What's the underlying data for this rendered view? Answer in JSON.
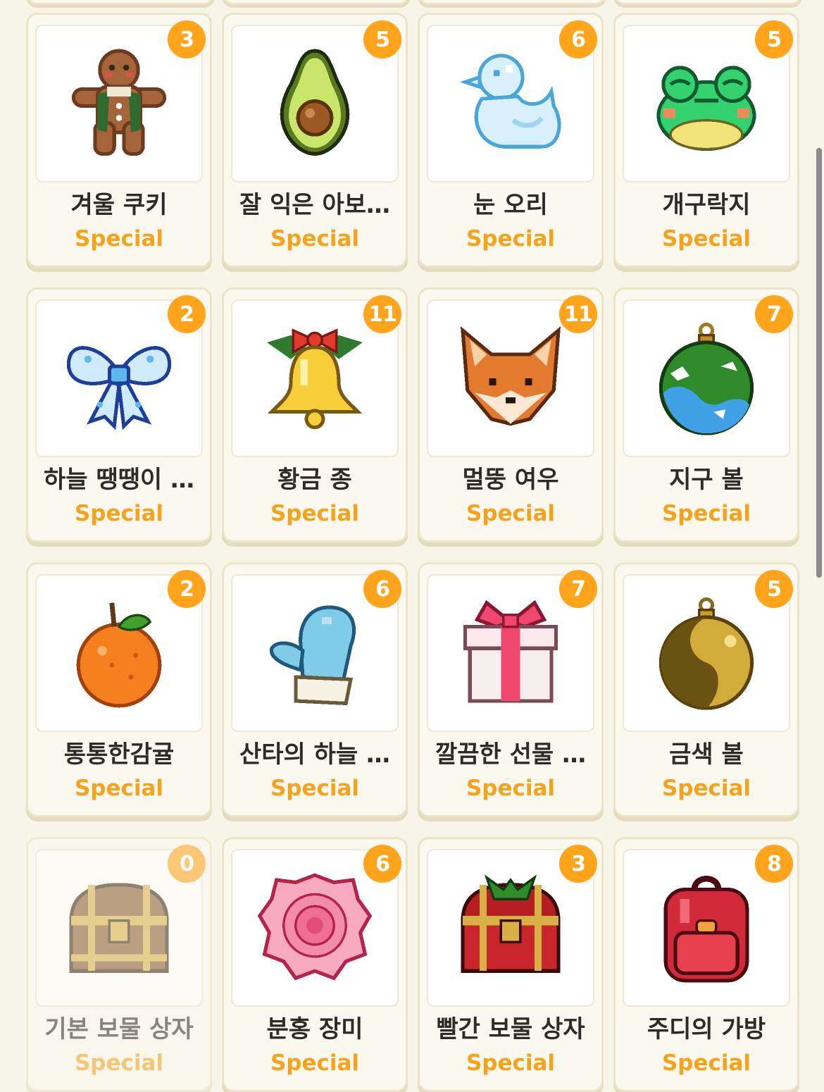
{
  "colors": {
    "background": "#f7f4e8",
    "card": "#fbf9ef",
    "badge": "#ffa41b",
    "rarity": "#f5a21c",
    "name": "#2f2a25"
  },
  "items": [
    {
      "name": "겨울 쿠키",
      "rarity": "Special",
      "count": "3",
      "icon": "gingerbread-man-icon"
    },
    {
      "name": "잘 익은 아보…",
      "rarity": "Special",
      "count": "5",
      "icon": "avocado-icon"
    },
    {
      "name": "눈 오리",
      "rarity": "Special",
      "count": "6",
      "icon": "snow-duck-icon"
    },
    {
      "name": "개구락지",
      "rarity": "Special",
      "count": "5",
      "icon": "frog-icon"
    },
    {
      "name": "하늘 땡땡이 …",
      "rarity": "Special",
      "count": "2",
      "icon": "blue-ribbon-bow-icon"
    },
    {
      "name": "황금 종",
      "rarity": "Special",
      "count": "11",
      "icon": "golden-bell-icon"
    },
    {
      "name": "멀뚱 여우",
      "rarity": "Special",
      "count": "11",
      "icon": "fox-face-icon"
    },
    {
      "name": "지구 볼",
      "rarity": "Special",
      "count": "7",
      "icon": "earth-ornament-icon"
    },
    {
      "name": "통통한감귤",
      "rarity": "Special",
      "count": "2",
      "icon": "tangerine-icon"
    },
    {
      "name": "산타의 하늘 …",
      "rarity": "Special",
      "count": "6",
      "icon": "blue-mitten-icon"
    },
    {
      "name": "깔끔한 선물 …",
      "rarity": "Special",
      "count": "7",
      "icon": "gift-box-icon"
    },
    {
      "name": "금색 볼",
      "rarity": "Special",
      "count": "5",
      "icon": "gold-ornament-icon"
    },
    {
      "name": "기본 보물 상자",
      "rarity": "Special",
      "count": "0",
      "icon": "treasure-chest-icon"
    },
    {
      "name": "분홍 장미",
      "rarity": "Special",
      "count": "6",
      "icon": "pink-rose-icon"
    },
    {
      "name": "빨간 보물 상자",
      "rarity": "Special",
      "count": "3",
      "icon": "red-treasure-chest-icon"
    },
    {
      "name": "주디의 가방",
      "rarity": "Special",
      "count": "8",
      "icon": "red-backpack-icon"
    }
  ]
}
